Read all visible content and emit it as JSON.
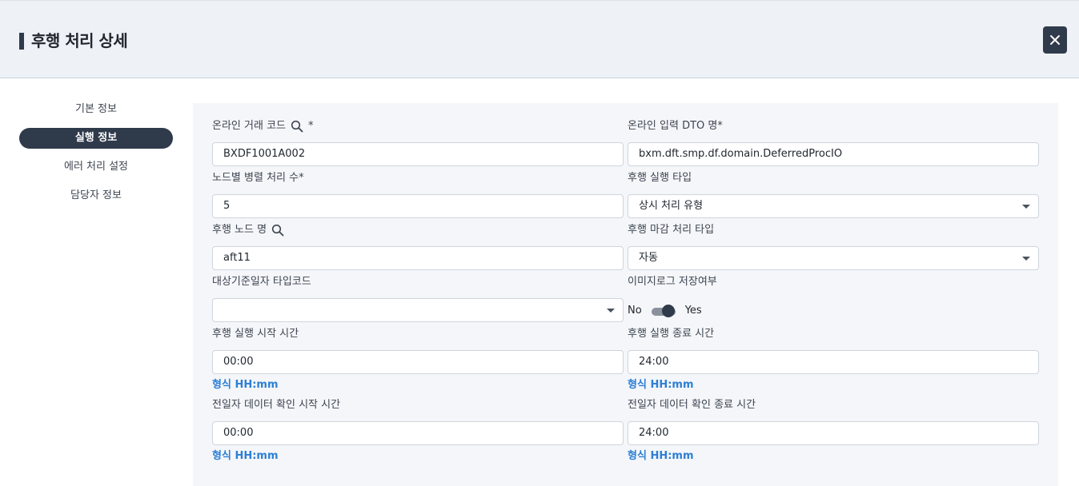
{
  "header": {
    "title": "후행 처리 상세",
    "close_icon": "close-icon"
  },
  "sidebar": {
    "items": [
      {
        "label": "기본 정보",
        "active": false
      },
      {
        "label": "실행 정보",
        "active": true
      },
      {
        "label": "에러 처리 설정",
        "active": false
      },
      {
        "label": "담당자 정보",
        "active": false
      }
    ]
  },
  "form": {
    "online_tx_code": {
      "label": "온라인 거래 코드",
      "required_mark": "*",
      "value": "BXDF1001A002"
    },
    "online_input_dto": {
      "label": "온라인 입력 DTO 명*",
      "value": "bxm.dft.smp.df.domain.DeferredProcIO"
    },
    "parallel_count": {
      "label": "노드별 병렬 처리 수*",
      "value": "5"
    },
    "exec_type": {
      "label": "후행 실행 타입",
      "value": "상시 처리 유형"
    },
    "node_name": {
      "label": "후행 노드 명",
      "value": "aft11"
    },
    "close_type": {
      "label": "후행 마감 처리 타입",
      "value": "자동"
    },
    "base_date_type": {
      "label": "대상기준일자 타입코드",
      "value": ""
    },
    "image_log": {
      "label": "이미지로그 저장여부",
      "off_label": "No",
      "on_label": "Yes",
      "enabled": true
    },
    "exec_start": {
      "label": "후행 실행 시작 시간",
      "value": "00:00",
      "hint": "형식 HH:mm"
    },
    "exec_end": {
      "label": "후행 실행 종료 시간",
      "value": "24:00",
      "hint": "형식 HH:mm"
    },
    "prev_start": {
      "label": "전일자 데이터 확인 시작 시간",
      "value": "00:00",
      "hint": "형식 HH:mm"
    },
    "prev_end": {
      "label": "전일자 데이터 확인 종료 시간",
      "value": "24:00",
      "hint": "형식 HH:mm"
    }
  },
  "colors": {
    "accent": "#2f3a4b",
    "hint": "#2d7fd4",
    "panel": "#f4f6f9",
    "header": "#eef1f6"
  }
}
